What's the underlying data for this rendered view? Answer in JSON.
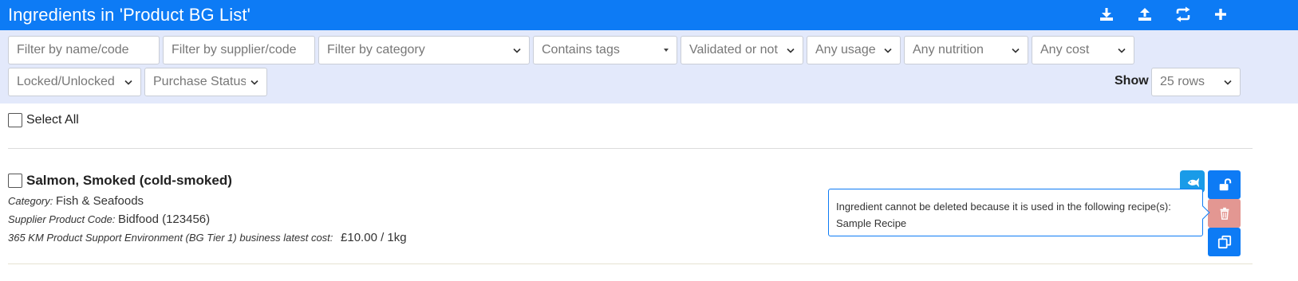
{
  "header": {
    "title": "Ingredients in 'Product BG List'",
    "actions": [
      {
        "name": "download-icon"
      },
      {
        "name": "upload-icon"
      },
      {
        "name": "transfer-icon"
      },
      {
        "name": "add-icon"
      }
    ]
  },
  "filters": {
    "name_code_placeholder": "Filter by name/code",
    "supplier_code_placeholder": "Filter by supplier/code",
    "category_selected": "Filter by category",
    "tags_selected": "Contains tags",
    "validated_selected": "Validated or not",
    "usage_selected": "Any usage",
    "nutrition_selected": "Any nutrition",
    "cost_selected": "Any cost",
    "locked_selected": "Locked/Unlocked",
    "purchase_status_selected": "Purchase Status",
    "show_label": "Show",
    "rows_selected": "25 rows"
  },
  "list": {
    "select_all_label": "Select All",
    "items": [
      {
        "name": "Salmon, Smoked (cold-smoked)",
        "category_label": "Category:",
        "category_value": "Fish & Seafoods",
        "supplier_label": "Supplier Product Code:",
        "supplier_value": "Bidfood (123456)",
        "cost_label": "365 KM Product Support Environment (BG Tier 1) business latest cost:",
        "cost_value": "£10.00 / 1kg",
        "category_icon": "fish-icon",
        "tooltip_line1": "Ingredient cannot be deleted because it is used in the following recipe(s):",
        "tooltip_line2": "Sample Recipe"
      }
    ]
  },
  "colors": {
    "header_bg": "#0d7bf5",
    "filter_bar_bg": "#e3e9fb",
    "primary_button": "#0d7bf5",
    "fish_badge": "#1a9be8",
    "disabled_delete": "#e39792"
  }
}
